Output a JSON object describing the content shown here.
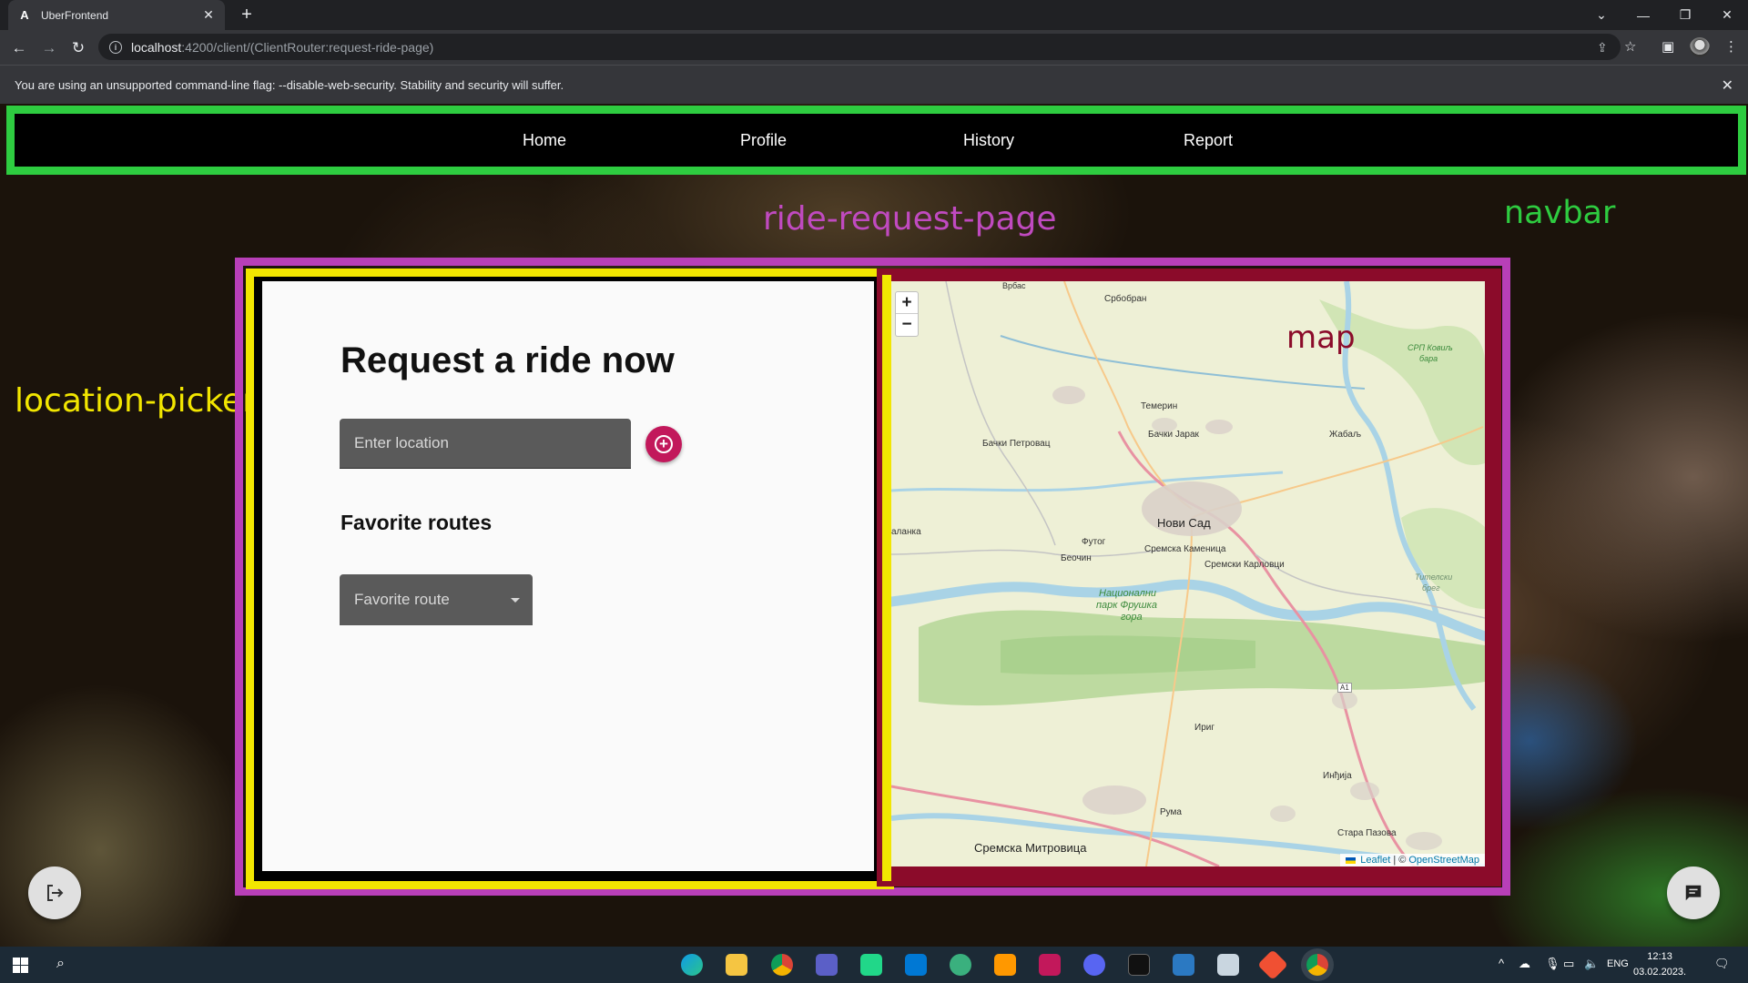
{
  "browser": {
    "tab_title": "UberFrontend",
    "tab_favicon": "A",
    "url_host": "localhost",
    "url_path": ":4200/client/(ClientRouter:request-ride-page)",
    "infobar_text": "You are using an unsupported command-line flag: --disable-web-security. Stability and security will suffer."
  },
  "navbar": {
    "links": [
      "Home",
      "Profile",
      "History",
      "Report"
    ]
  },
  "debug_labels": {
    "ride_request_page": "ride-request-page",
    "navbar": "navbar",
    "location_picker": "location-picker",
    "map": "map"
  },
  "debug_colors": {
    "navbar": "#2ecc40",
    "ride_request_page": "#b83fb8",
    "location_picker": "#f2e600",
    "map": "#8b0b2a"
  },
  "request_card": {
    "title": "Request a ride now",
    "location_placeholder": "Enter location",
    "favorites_title": "Favorite routes",
    "favorite_select_placeholder": "Favorite route"
  },
  "map": {
    "zoom_in": "+",
    "zoom_out": "−",
    "attribution": {
      "leaflet": "Leaflet",
      "separator": "| ©",
      "osm": "OpenStreetMap"
    },
    "places": [
      "Сремска Митровица",
      "Нови Сад",
      "Сремска Каменица",
      "Сремски Карловци",
      "Бачки Петровац",
      "Бачки Јарак",
      "Темерин",
      "Жабаљ",
      "Србобран",
      "Футог",
      "Беочин",
      "Ириг",
      "Инђија",
      "Рума",
      "Стара Пазова",
      "Врбас",
      "аланка",
      "Национални",
      "парк Фрушка",
      "гора",
      "СРП Ковиљ",
      "бара",
      "Тителски",
      "брег",
      "A1"
    ]
  },
  "taskbar": {
    "time": "12:13",
    "date": "03.02.2023.",
    "lang": "ENG"
  }
}
